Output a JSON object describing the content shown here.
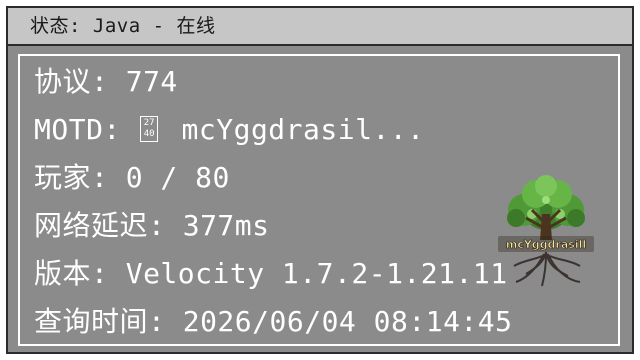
{
  "window": {
    "title": "状态: Java - 在线"
  },
  "rows": {
    "protocol": "协议: 774",
    "motd_prefix": "MOTD: ",
    "motd_glyph_top": "27",
    "motd_glyph_bottom": "40",
    "motd_text": " mcYggdrasil...",
    "players": "玩家: 0 / 80",
    "latency": "网络延迟: 377ms",
    "version": "版本: Velocity 1.7.2-1.21.11",
    "query_time": "查询时间: 2026/06/04 08:14:45"
  },
  "logo": {
    "label": "mcYggdrasill",
    "icon": "tree-logo-icon"
  },
  "colors": {
    "panel_background": "#8b8b8b",
    "title_bar_background": "#c6c6c6",
    "text": "#ffffff",
    "title_text": "#1a1a1a",
    "border_dark": "#2b2b2b"
  }
}
